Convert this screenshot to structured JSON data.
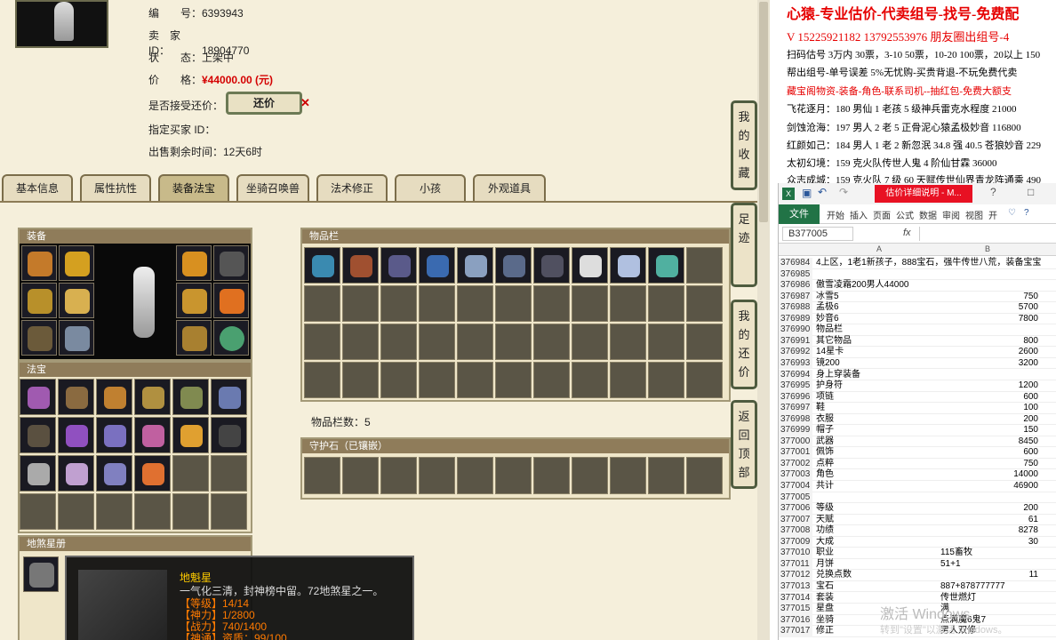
{
  "seller_info": {
    "serial_label": "编　　号：",
    "serial": "6393943",
    "seller_label": "卖　家　ID：",
    "seller_id": "18904770",
    "status_label": "状　　态：",
    "status": "上架中",
    "price_label": "价　　格：",
    "price": "¥44000.00 (元)",
    "counter_label": "是否接受还价：",
    "counter_button": "还价",
    "buyer_label": "指定买家 ID：",
    "buyer_id": "",
    "remaining_label": "出售剩余时间：",
    "remaining": "12天6时"
  },
  "tabs": [
    "基本信息",
    "属性抗性",
    "装备法宝",
    "坐骑召唤兽",
    "法术修正",
    "小孩",
    "外观道具"
  ],
  "active_tab": "装备法宝",
  "panels": {
    "equipment": "装备",
    "magic": "法宝",
    "items": "物品栏",
    "items_count": "物品栏数：5",
    "guard": "守护石（已镶嵌）",
    "stars": "地煞星册"
  },
  "side_buttons": [
    "我的收藏",
    "足迹",
    "我的还价",
    "返回顶部"
  ],
  "tooltip": {
    "name": "地魁星",
    "desc": "一气化三清，封神榜中留。72地煞星之一。",
    "lines": [
      "【等级】14/14",
      "【神力】1/2800",
      "【战力】740/1400",
      "【神通】资质：99/100"
    ]
  },
  "promo": [
    {
      "text": "心猿-专业估价-代卖组号-找号-免费配",
      "color": "#e60000"
    },
    {
      "text": "V 15225921182   13792553976 朋友圈出组号-4",
      "color": "#e60000"
    },
    {
      "text": "扫码估号 3万内 30票，3-10 50票，10-20 100票，20以上 150",
      "color": "#000000"
    },
    {
      "text": "帮出组号-单号误差 5%无忧购-买贵背退-不玩免费代卖",
      "color": "#000000"
    },
    {
      "text": "藏宝阁物资-装备-角色-联系司机--抽红包-免费大额支",
      "color": "#e60000"
    },
    {
      "text": "飞花逐月：180 男仙 1 老孩 5 级神兵雷克水程度 21000",
      "color": "#000000"
    },
    {
      "text": "剑蚀沧海：197 男人 2 老 5 正骨泥心猿孟极妙音 116800",
      "color": "#000000"
    },
    {
      "text": "红颜如己：184 男人 1 老 2 新忽泯 34.8 强 40.5 苍狼妙音 229",
      "color": "#000000"
    },
    {
      "text": "太初幻境：159 克火队传世人鬼 4 阶仙甘霖 36000",
      "color": "#000000"
    },
    {
      "text": "众志成城：159 克火队 7 级 60 天赋传世仙界青龙阵通乘 490",
      "color": "#000000"
    }
  ],
  "excel": {
    "window_title": "估价详细说明 - M...",
    "ribbon": [
      "文件",
      "开始",
      "插入",
      "页面",
      "公式",
      "数据",
      "审阅",
      "视图",
      "开"
    ],
    "name_box": "B377005",
    "fx": "fx",
    "columns": [
      "A",
      "B"
    ],
    "rows": [
      {
        "n": "376984",
        "a": "4上区，1老1新孩子，888宝石，强牛传世八荒，装备宝宝",
        "b": "",
        "bl": ""
      },
      {
        "n": "376985",
        "a": "",
        "b": "",
        "bl": ""
      },
      {
        "n": "376986",
        "a": "傲雪凌霜200男人44000",
        "b": "",
        "bl": ""
      },
      {
        "n": "376987",
        "a": "冰雪5",
        "b": "750",
        "bl": ""
      },
      {
        "n": "376988",
        "a": "孟极6",
        "b": "5700",
        "bl": ""
      },
      {
        "n": "376989",
        "a": "妙音6",
        "b": "7800",
        "bl": ""
      },
      {
        "n": "376990",
        "a": "物品栏",
        "b": "",
        "bl": ""
      },
      {
        "n": "376991",
        "a": "其它物品",
        "b": "800",
        "bl": ""
      },
      {
        "n": "376992",
        "a": "14星卡",
        "b": "2600",
        "bl": ""
      },
      {
        "n": "376993",
        "a": "镜200",
        "b": "3200",
        "bl": ""
      },
      {
        "n": "376994",
        "a": "身上穿装备",
        "b": "",
        "bl": ""
      },
      {
        "n": "376995",
        "a": "护身符",
        "b": "1200",
        "bl": ""
      },
      {
        "n": "376996",
        "a": "项链",
        "b": "600",
        "bl": ""
      },
      {
        "n": "376997",
        "a": "鞋",
        "b": "100",
        "bl": ""
      },
      {
        "n": "376998",
        "a": "衣服",
        "b": "200",
        "bl": ""
      },
      {
        "n": "376999",
        "a": "帽子",
        "b": "150",
        "bl": ""
      },
      {
        "n": "377000",
        "a": "武器",
        "b": "8450",
        "bl": ""
      },
      {
        "n": "377001",
        "a": "佩饰",
        "b": "600",
        "bl": ""
      },
      {
        "n": "377002",
        "a": "点粹",
        "b": "750",
        "bl": ""
      },
      {
        "n": "377003",
        "a": "角色",
        "b": "14000",
        "bl": ""
      },
      {
        "n": "377004",
        "a": "共计",
        "b": "46900",
        "bl": ""
      },
      {
        "n": "377005",
        "a": "",
        "b": "",
        "bl": ""
      },
      {
        "n": "377006",
        "a": "等级",
        "b": "200",
        "bl": ""
      },
      {
        "n": "377007",
        "a": "天赋",
        "b": "61",
        "bl": ""
      },
      {
        "n": "377008",
        "a": "功绩",
        "b": "8278",
        "bl": ""
      },
      {
        "n": "377009",
        "a": "大成",
        "b": "30",
        "bl": ""
      },
      {
        "n": "377010",
        "a": "职业",
        "b": "",
        "bl": "115畜牧"
      },
      {
        "n": "377011",
        "a": "月饼",
        "b": "",
        "bl": "51+1"
      },
      {
        "n": "377012",
        "a": "兑换点数",
        "b": "11",
        "bl": ""
      },
      {
        "n": "377013",
        "a": "宝石",
        "b": "",
        "bl": "887+878777777"
      },
      {
        "n": "377014",
        "a": "套装",
        "b": "",
        "bl": "传世燃灯"
      },
      {
        "n": "377015",
        "a": "星盘",
        "b": "",
        "bl": "满"
      },
      {
        "n": "377016",
        "a": "坐骑",
        "b": "",
        "bl": "点满魔6鬼7"
      },
      {
        "n": "377017",
        "a": "修正",
        "b": "",
        "bl": "男人双修"
      }
    ]
  },
  "watermark": {
    "line1": "激活 Windows",
    "line2": "转到\"设置\"以激活 Windows。"
  },
  "colors": {
    "price": "#d40000",
    "promo_red": "#e60000",
    "excel_green": "#217346",
    "tab_border": "#7b6d4a"
  },
  "icons": [
    "close-icon",
    "excel-icon",
    "save-icon",
    "undo-icon",
    "redo-icon",
    "help-icon",
    "ribbon-collapse-icon"
  ]
}
